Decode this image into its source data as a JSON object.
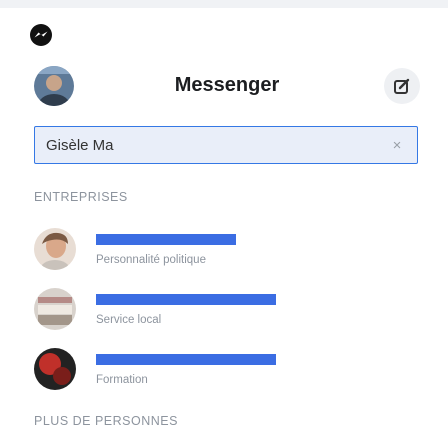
{
  "header": {
    "title": "Messenger"
  },
  "search": {
    "value": "Gisèle Ma",
    "clear_glyph": "×"
  },
  "sections": {
    "businesses": "ENTREPRISES",
    "more_people": "PLUS DE PERSONNES"
  },
  "results": [
    {
      "name": "",
      "subtitle": "Personnalité politique"
    },
    {
      "name": "",
      "subtitle": "Service local"
    },
    {
      "name": "",
      "subtitle": "Formation"
    }
  ],
  "icons": {
    "logo": "messenger-logo-icon",
    "compose": "compose-icon",
    "clear": "close-icon"
  },
  "colors": {
    "accent": "#3578e5",
    "redaction": "#3b6de3",
    "search_bg": "#e9eef9",
    "muted_text": "#8d949e"
  }
}
